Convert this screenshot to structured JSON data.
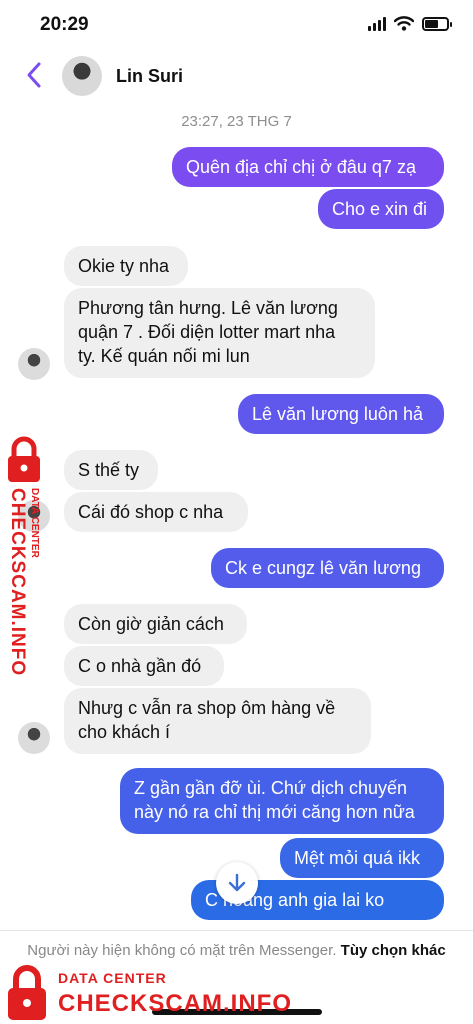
{
  "status_bar": {
    "time": "20:29"
  },
  "header": {
    "contact_name": "Lin Suri"
  },
  "chat": {
    "timestamp": "23:27, 23 THG 7",
    "outgoing_color": "#7b4cf0",
    "messages": [
      {
        "direction": "out",
        "text": "Quên địa chỉ chị ở đâu q7 zạ"
      },
      {
        "direction": "out",
        "text": "Cho e xin đi"
      },
      {
        "direction": "in",
        "text": "Okie ty nha"
      },
      {
        "direction": "in",
        "text": "Phương tân hưng.  Lê văn lương\nquận 7 . Đối diện lotter mart nha\nty.  Kế quán nối mi lun"
      },
      {
        "direction": "out",
        "text": "Lê văn lương luôn hả"
      },
      {
        "direction": "in",
        "text": "S thế ty"
      },
      {
        "direction": "in",
        "text": "Cái đó shop c nha"
      },
      {
        "direction": "out",
        "text": "Ck e cungz lê văn lương"
      },
      {
        "direction": "in",
        "text": "Còn giờ giản cách"
      },
      {
        "direction": "in",
        "text": "C o nhà gần đó"
      },
      {
        "direction": "in",
        "text": "Nhưg c vẫn ra shop ôm hàng về\ncho khách í"
      },
      {
        "direction": "out",
        "text": "Z gần gần đỡ ùi. Chứ dịch chuyến\nnày nó ra chỉ thị mới căng hơn nữa"
      },
      {
        "direction": "out",
        "text": "Mệt mỏi quá ikk"
      },
      {
        "direction": "out",
        "text": "C   hoàng anh gia lai ko"
      }
    ]
  },
  "footer": {
    "notice": "Người này hiện không có mặt trên Messenger.",
    "options_label": "Tùy chọn khác"
  },
  "watermark": {
    "small": "DATA CENTER",
    "big": "CHECKSCAM.INFO",
    "color": "#e02020"
  },
  "icons": [
    "chevron-left-icon",
    "arrow-down-icon",
    "signal-icon",
    "wifi-icon",
    "battery-icon",
    "lock-icon"
  ]
}
